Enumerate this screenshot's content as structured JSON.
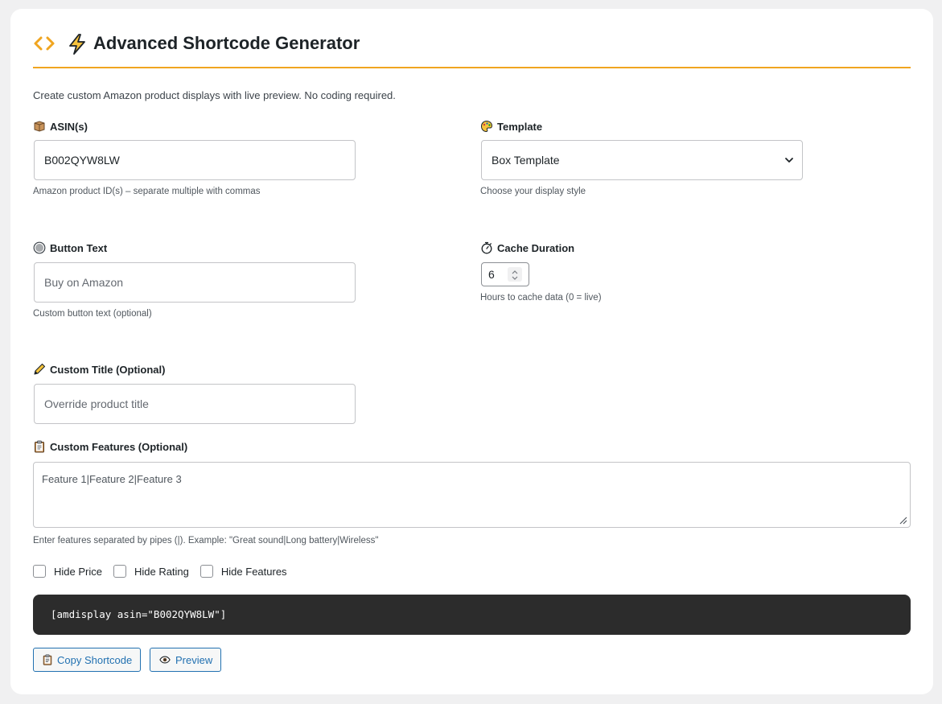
{
  "header": {
    "title": "Advanced Shortcode Generator",
    "accent_color": "#f0a520",
    "icons": [
      "code-icon",
      "lightning-bolt-icon"
    ]
  },
  "intro": "Create custom Amazon product displays with live preview. No coding required.",
  "fields": {
    "asin": {
      "label": "ASIN(s)",
      "icon": "package-icon",
      "value": "B002QYW8LW",
      "help": "Amazon product ID(s) – separate multiple with commas"
    },
    "template": {
      "label": "Template",
      "icon": "palette-icon",
      "selected": "Box Template",
      "help": "Choose your display style"
    },
    "button_text": {
      "label": "Button Text",
      "icon": "radio-button-icon",
      "placeholder": "Buy on Amazon",
      "help": "Custom button text (optional)"
    },
    "cache": {
      "label": "Cache Duration",
      "icon": "stopwatch-icon",
      "value": "6",
      "help": "Hours to cache data (0 = live)"
    },
    "custom_title": {
      "label": "Custom Title (Optional)",
      "icon": "pencil-icon",
      "placeholder": "Override product title"
    },
    "custom_features": {
      "label": "Custom Features (Optional)",
      "icon": "clipboard-icon",
      "placeholder": "Feature 1|Feature 2|Feature 3",
      "help": "Enter features separated by pipes (|). Example: \"Great sound|Long battery|Wireless\""
    }
  },
  "checkboxes": [
    {
      "label": "Hide Price",
      "checked": false
    },
    {
      "label": "Hide Rating",
      "checked": false
    },
    {
      "label": "Hide Features",
      "checked": false
    }
  ],
  "shortcode": "[amdisplay asin=\"B002QYW8LW\"]",
  "buttons": {
    "copy": "Copy Shortcode",
    "preview": "Preview"
  }
}
